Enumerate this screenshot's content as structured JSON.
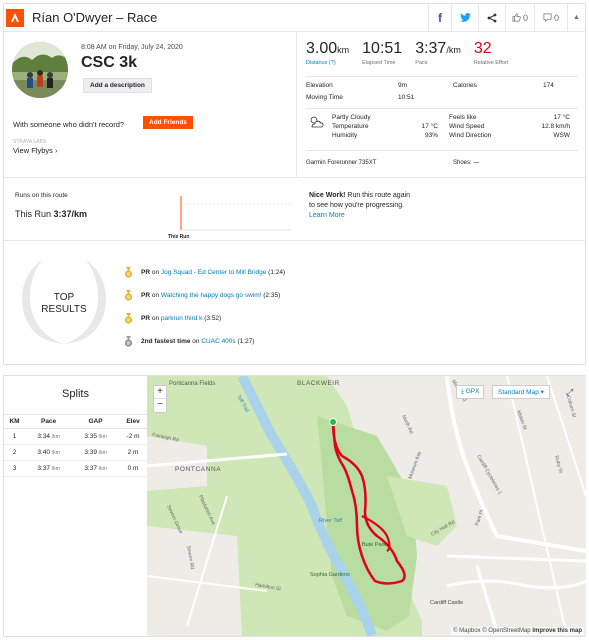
{
  "header": {
    "title": "Rían O'Dwyer – Race",
    "kudos_count": "0",
    "comment_count": "0"
  },
  "activity": {
    "date": "8:08 AM on Friday, July 24, 2020",
    "name": "CSC 3k",
    "add_description": "Add a description",
    "someone_text": "With someone who didn't record?",
    "add_friends": "Add Friends",
    "flyby_small": "STRAVA LABS",
    "view_flybys": "View Flybys"
  },
  "stats": {
    "distance_val": "3.00",
    "distance_unit": "km",
    "distance_label": "Distance (?)",
    "elapsed_val": "10:51",
    "elapsed_label": "Elapsed Time",
    "pace_val": "3:37",
    "pace_unit": "/km",
    "pace_label": "Pace",
    "effort_val": "32",
    "effort_label": "Relative Effort"
  },
  "details": {
    "elevation_label": "Elevation",
    "elevation_val": "9m",
    "calories_label": "Calories",
    "calories_val": "174",
    "moving_label": "Moving Time",
    "moving_val": "10:51",
    "weather_condition": "Partly Cloudy",
    "temperature_label": "Temperature",
    "temperature_val": "17 °C",
    "humidity_label": "Humidity",
    "humidity_val": "93%",
    "feels_label": "Feels like",
    "feels_val": "17 °C",
    "wind_speed_label": "Wind Speed",
    "wind_speed_val": "12.8 km/h",
    "wind_dir_label": "Wind Direction",
    "wind_dir_val": "WSW",
    "device": "Garmin Forerunner 735XT",
    "shoes": "Shoes: —"
  },
  "route": {
    "runs_label": "Runs on this route",
    "this_run_label": "This Run",
    "this_run_pace": "3:37/km",
    "chart_label": "This Run",
    "nice_bold": "Nice Work!",
    "nice_text1": " Run this route again",
    "nice_text2": "to see how you're progressing.",
    "learn_more": "Learn More"
  },
  "results": {
    "top_line1": "TOP",
    "top_line2": "RESULTS",
    "items": [
      {
        "prefix": "PR",
        "mid": " on ",
        "segment": "Jog Squad - Ed Center to Mill Bridge",
        "time": " (1:24)",
        "medal": "gold"
      },
      {
        "prefix": "PR",
        "mid": " on ",
        "segment": "Watching the happy dogs go swim!",
        "time": " (2:35)",
        "medal": "gold"
      },
      {
        "prefix": "PR",
        "mid": " on ",
        "segment": "parkrun third k",
        "time": " (3:52)",
        "medal": "gold"
      },
      {
        "prefix": "2nd fastest time",
        "mid": " on ",
        "segment": "CUAC 400s",
        "time": " (1:27)",
        "medal": "silver"
      }
    ]
  },
  "splits": {
    "title": "Splits",
    "headers": [
      "KM",
      "Pace",
      "GAP",
      "Elev"
    ],
    "rows": [
      {
        "km": "1",
        "pace": "3:34",
        "gap": "3:35",
        "elev": "-2 m"
      },
      {
        "km": "2",
        "pace": "3:40",
        "gap": "3:39",
        "elev": "2 m"
      },
      {
        "km": "3",
        "pace": "3:37",
        "gap": "3:37",
        "elev": "0 m"
      }
    ],
    "unit": "/km"
  },
  "map": {
    "gpx": "GPX",
    "style": "Standard Map",
    "attribution": "© Mapbox © OpenStreetMap",
    "improve": "Improve this map",
    "labels": {
      "pontcanna_fields": "Pontcanna Fields",
      "blackweir": "BLACKWEIR",
      "pontcanna": "PONTCANNA",
      "river_taff": "River Taff",
      "bute_park": "Bute Park",
      "sophia": "Sophia Gardens",
      "castle": "Cardiff Castle",
      "fairleigh": "Fairleigh Rd",
      "severn": "Severn Grove",
      "plasturton": "Plasturton Ave",
      "museum": "Museum Ave",
      "park_pl": "Park Pl",
      "city_hall": "City Hall Rd",
      "cathays": "Cardiff Cyclelanes 1",
      "miskin": "Miskin St",
      "hamilton": "Hamilton St",
      "severn_rd": "Severn Rd",
      "ruby": "Ruby St",
      "coburn": "Coburn St",
      "north_rd": "North Rd",
      "taff_trail": "Taff Trail",
      "maindy": "Maindy Rd"
    }
  }
}
